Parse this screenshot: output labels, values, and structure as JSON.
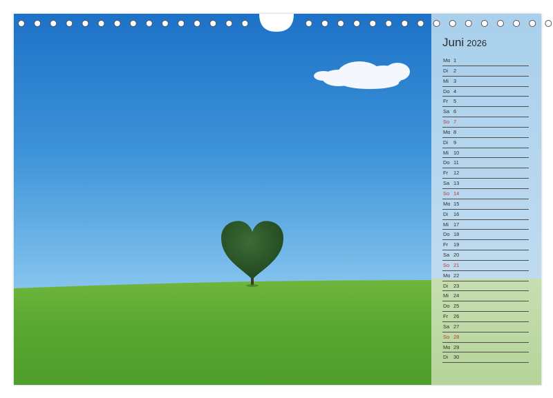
{
  "calendar": {
    "month": "Juni",
    "year": "2026",
    "days": [
      {
        "dn": "Mo",
        "d": "1"
      },
      {
        "dn": "Di",
        "d": "2"
      },
      {
        "dn": "Mi",
        "d": "3"
      },
      {
        "dn": "Do",
        "d": "4"
      },
      {
        "dn": "Fr",
        "d": "5"
      },
      {
        "dn": "Sa",
        "d": "6"
      },
      {
        "dn": "So",
        "d": "7"
      },
      {
        "dn": "Mo",
        "d": "8"
      },
      {
        "dn": "Di",
        "d": "9"
      },
      {
        "dn": "Mi",
        "d": "10"
      },
      {
        "dn": "Do",
        "d": "11"
      },
      {
        "dn": "Fr",
        "d": "12"
      },
      {
        "dn": "Sa",
        "d": "13"
      },
      {
        "dn": "So",
        "d": "14"
      },
      {
        "dn": "Mo",
        "d": "15"
      },
      {
        "dn": "Di",
        "d": "16"
      },
      {
        "dn": "Mi",
        "d": "17"
      },
      {
        "dn": "Do",
        "d": "18"
      },
      {
        "dn": "Fr",
        "d": "19"
      },
      {
        "dn": "Sa",
        "d": "20"
      },
      {
        "dn": "So",
        "d": "21"
      },
      {
        "dn": "Mo",
        "d": "22"
      },
      {
        "dn": "Di",
        "d": "23"
      },
      {
        "dn": "Mi",
        "d": "24"
      },
      {
        "dn": "Do",
        "d": "25"
      },
      {
        "dn": "Fr",
        "d": "26"
      },
      {
        "dn": "Sa",
        "d": "27"
      },
      {
        "dn": "So",
        "d": "28"
      },
      {
        "dn": "Mo",
        "d": "29"
      },
      {
        "dn": "Di",
        "d": "30"
      }
    ]
  },
  "colors": {
    "sky_top": "#1f75c9",
    "sky_bottom": "#7fc0ec",
    "grass": "#5aa534",
    "sunday": "#c0392b"
  }
}
